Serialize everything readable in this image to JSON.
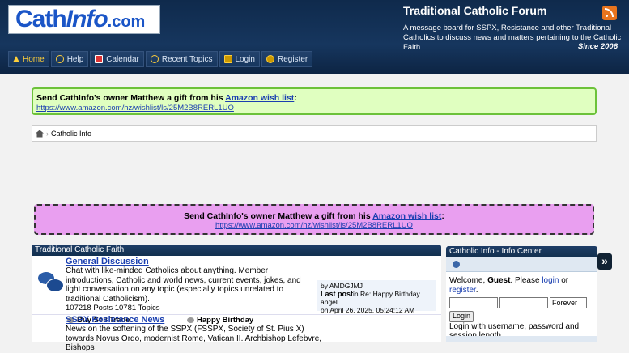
{
  "header": {
    "logo": {
      "part1": "Cath",
      "part2": "Info",
      "part3": ".com"
    },
    "title": "Traditional Catholic Forum",
    "description": "A message board for SSPX, Resistance and other Traditional Catholics to discuss news and matters pertaining to the Catholic Faith.",
    "since": "Since 2006",
    "rss_icon": "rss-icon"
  },
  "nav": [
    {
      "label": "Home",
      "icon": "home-icon"
    },
    {
      "label": "Help",
      "icon": "help-icon"
    },
    {
      "label": "Calendar",
      "icon": "calendar-icon"
    },
    {
      "label": "Recent Topics",
      "icon": "help-icon"
    },
    {
      "label": "Login",
      "icon": "lock-icon"
    },
    {
      "label": "Register",
      "icon": "key-icon"
    }
  ],
  "gift_banner": {
    "text": "Send CathInfo's owner Matthew a gift from his",
    "link": "Amazon wish list",
    "colon": ":",
    "url": "https://www.amazon.com/hz/wishlist/ls/25M2B8RERL1UO"
  },
  "breadcrumb": {
    "item": "Catholic Info"
  },
  "category": {
    "title": "Traditional Catholic Faith",
    "boards": [
      {
        "title": "General Discussion",
        "description": "Chat with like-minded Catholics about anything. Member introductions, Catholic and world news, current events, jokes, and light conversation on any topic (especially topics unrelated to traditional Catholicism).",
        "stats": "107218 Posts 10781 Topics",
        "children": [
          "Buy Sell Trade",
          "Happy Birthday"
        ],
        "last_post": {
          "by": "by AMDGJMJ",
          "label": "Last post",
          "in": "in Re: Happy Birthday angel...",
          "date": "on April 26, 2025, 05:24:12 AM"
        }
      },
      {
        "title": "SSPX Resistance News",
        "description": "News on the softening of the SSPX (FSSPX, Society of St. Pius X) towards Novus Ordo, modernist Rome, Vatican II. Archbishop Lefebvre, Bishops"
      }
    ]
  },
  "info_center": {
    "title": "Catholic Info - Info Center",
    "welcome_prefix": "Welcome,",
    "guest": "Guest",
    "please": ". Please",
    "login_link": "login",
    "or": "or",
    "register_link": "register",
    "period": ".",
    "duration": "Forever",
    "login_button": "Login",
    "hint": "Login with username, password and session length"
  },
  "side_toggle": "»"
}
